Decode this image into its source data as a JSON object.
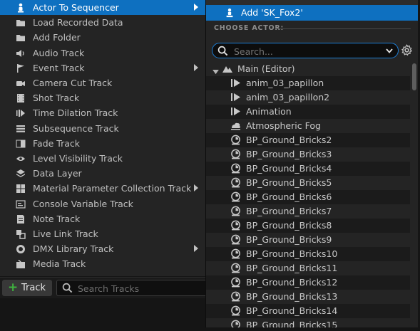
{
  "menu": {
    "items": [
      {
        "label": "Actor To Sequencer",
        "icon": "actor-to-sequencer-icon",
        "has_submenu": true,
        "active": true
      },
      {
        "label": "Load Recorded Data",
        "icon": "folder-icon",
        "has_submenu": false
      },
      {
        "label": "Add Folder",
        "icon": "folder-icon",
        "has_submenu": false
      },
      {
        "label": "Audio Track",
        "icon": "speaker-icon",
        "has_submenu": false
      },
      {
        "label": "Event Track",
        "icon": "flag-icon",
        "has_submenu": true
      },
      {
        "label": "Camera Cut Track",
        "icon": "camera-icon",
        "has_submenu": false
      },
      {
        "label": "Shot Track",
        "icon": "film-icon",
        "has_submenu": false
      },
      {
        "label": "Time Dilation Track",
        "icon": "time-dilation-icon",
        "has_submenu": false
      },
      {
        "label": "Subsequence Track",
        "icon": "subsequence-icon",
        "has_submenu": false
      },
      {
        "label": "Fade Track",
        "icon": "fade-icon",
        "has_submenu": false
      },
      {
        "label": "Level Visibility Track",
        "icon": "level-visibility-icon",
        "has_submenu": false
      },
      {
        "label": "Data Layer",
        "icon": "layers-icon",
        "has_submenu": false
      },
      {
        "label": "Material Parameter Collection Track",
        "icon": "material-parameter-icon",
        "has_submenu": true
      },
      {
        "label": "Console Variable Track",
        "icon": "console-icon",
        "has_submenu": false
      },
      {
        "label": "Note Track",
        "icon": "note-icon",
        "has_submenu": false
      },
      {
        "label": "Live Link Track",
        "icon": "live-link-icon",
        "has_submenu": false
      },
      {
        "label": "DMX Library Track",
        "icon": "dmx-icon",
        "has_submenu": true
      },
      {
        "label": "Media Track",
        "icon": "media-icon",
        "has_submenu": false
      }
    ]
  },
  "toolbar": {
    "add_track_label": "Track",
    "search_placeholder": "Search Tracks"
  },
  "actor_panel": {
    "add_actor_label": "Add 'SK_Fox2'",
    "choose_actor_heading": "CHOOSE ACTOR:",
    "search_placeholder": "Search...",
    "tree_root_label": "Main (Editor)",
    "actors": [
      {
        "label": "anim_03_papillon",
        "icon": "animation-icon"
      },
      {
        "label": "anim_03_papillon2",
        "icon": "animation-icon"
      },
      {
        "label": "Animation",
        "icon": "animation-icon"
      },
      {
        "label": "Atmospheric Fog",
        "icon": "fog-icon"
      },
      {
        "label": "BP_Ground_Bricks2",
        "icon": "blueprint-actor-icon"
      },
      {
        "label": "BP_Ground_Bricks3",
        "icon": "blueprint-actor-icon"
      },
      {
        "label": "BP_Ground_Bricks4",
        "icon": "blueprint-actor-icon"
      },
      {
        "label": "BP_Ground_Bricks5",
        "icon": "blueprint-actor-icon"
      },
      {
        "label": "BP_Ground_Bricks6",
        "icon": "blueprint-actor-icon"
      },
      {
        "label": "BP_Ground_Bricks7",
        "icon": "blueprint-actor-icon"
      },
      {
        "label": "BP_Ground_Bricks8",
        "icon": "blueprint-actor-icon"
      },
      {
        "label": "BP_Ground_Bricks9",
        "icon": "blueprint-actor-icon"
      },
      {
        "label": "BP_Ground_Bricks10",
        "icon": "blueprint-actor-icon"
      },
      {
        "label": "BP_Ground_Bricks11",
        "icon": "blueprint-actor-icon"
      },
      {
        "label": "BP_Ground_Bricks12",
        "icon": "blueprint-actor-icon"
      },
      {
        "label": "BP_Ground_Bricks13",
        "icon": "blueprint-actor-icon"
      },
      {
        "label": "BP_Ground_Bricks14",
        "icon": "blueprint-actor-icon"
      },
      {
        "label": "BP_Ground_Bricks15",
        "icon": "blueprint-actor-icon"
      }
    ]
  },
  "colors": {
    "accent": "#0e70c0",
    "panel_bg": "#242424",
    "add_green": "#3fb23f"
  }
}
